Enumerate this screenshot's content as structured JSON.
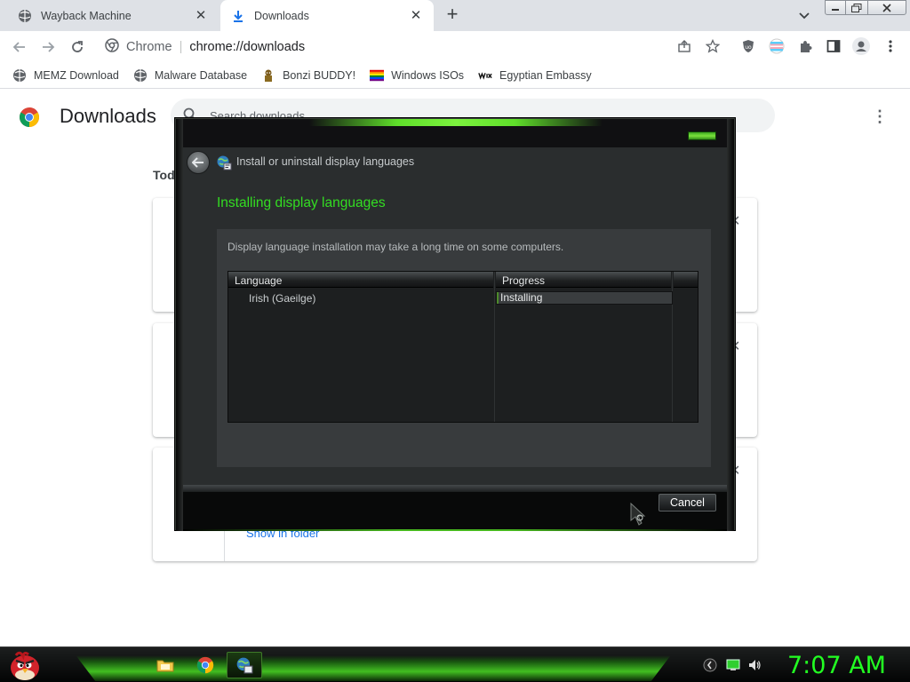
{
  "browser": {
    "tabs": [
      {
        "label": "Wayback Machine",
        "active": false
      },
      {
        "label": "Downloads",
        "active": true
      }
    ],
    "omnibox": {
      "site": "Chrome",
      "separator": "|",
      "url": "chrome://downloads"
    },
    "bookmarks": [
      {
        "label": "MEMZ Download",
        "icon": "globe-icon"
      },
      {
        "label": "Malware Database",
        "icon": "globe-icon"
      },
      {
        "label": "Bonzi BUDDY!",
        "icon": "bonzi-icon"
      },
      {
        "label": "Windows ISOs",
        "icon": "rainbow-flag-icon"
      },
      {
        "label": "Egyptian Embassy",
        "icon": "wix-icon"
      }
    ]
  },
  "downloads_page": {
    "title": "Downloads",
    "search_placeholder": "Search downloads",
    "section_label": "Tod",
    "show_in_folder": "Show in folder"
  },
  "dialog": {
    "header_title": "Install or uninstall display languages",
    "heading": "Installing display languages",
    "description": "Display language installation may take a long time on some computers.",
    "columns": [
      "Language",
      "Progress"
    ],
    "rows": [
      {
        "language": "Irish (Gaeilge)",
        "progress_text": "Installing",
        "progress": 0.01
      }
    ],
    "cancel_label": "Cancel"
  },
  "taskbar": {
    "clock": "7:07 AM",
    "accent_color": "#22ff22"
  },
  "colors": {
    "dialog_heading": "#33dd22",
    "link": "#1a73e8",
    "tabstrip": "#dee1e6"
  }
}
